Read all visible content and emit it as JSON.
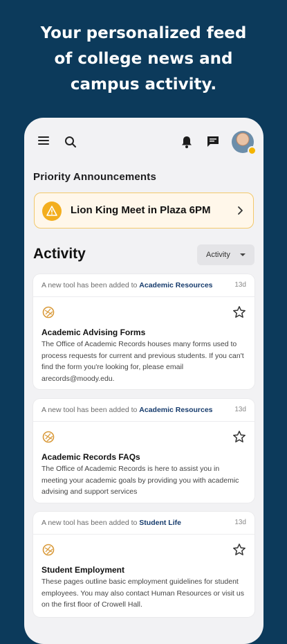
{
  "headline": {
    "line1": "Your personalized feed",
    "line2": "of college news and",
    "line3": "campus activity."
  },
  "topbar": {
    "icons": [
      "menu-icon",
      "search-icon",
      "bell-icon",
      "chat-icon",
      "avatar"
    ]
  },
  "priority": {
    "title": "Priority Announcements",
    "announcement": "Lion King Meet in Plaza 6PM"
  },
  "activity": {
    "title": "Activity",
    "filter_label": "Activity",
    "cards": [
      {
        "prefix": "A new tool has been added to ",
        "category": "Academic Resources",
        "age": "13d",
        "title": "Academic Advising Forms",
        "description": "The Office of Academic Records houses many forms used to process requests for current and previous students. If you can't find the form you're looking for, please email arecords@moody.edu."
      },
      {
        "prefix": "A new tool has been added to ",
        "category": "Academic Resources",
        "age": "13d",
        "title": "Academic Records FAQs",
        "description": "The Office of Academic Records is here to assist you in meeting your academic goals by providing you with academic advising and support services"
      },
      {
        "prefix": "A new tool has been added to ",
        "category": "Student Life",
        "age": "13d",
        "title": "Student Employment",
        "description": "These pages outline basic employment guidelines for student employees. You may also contact Human Resources or visit us on the first floor of Crowell Hall."
      }
    ]
  },
  "colors": {
    "background": "#0c3a5b",
    "accent_link": "#173c6d",
    "warning": "#f3ae1f",
    "tool_icon": "#d99a3a"
  }
}
